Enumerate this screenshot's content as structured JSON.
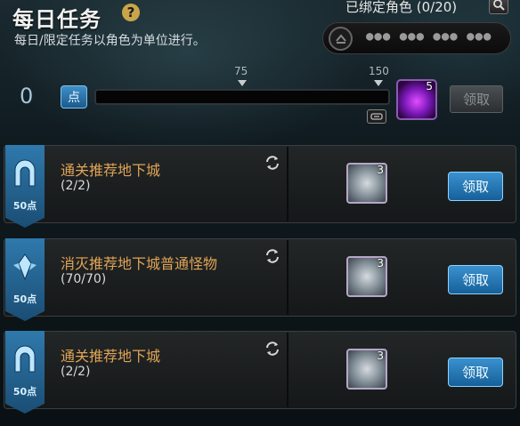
{
  "header": {
    "title": "每日任务",
    "help_icon": "question-mark-icon",
    "subtitle": "每日/限定任务以角色为单位进行。",
    "bound_label": "已绑定角色 (0/20)",
    "character_placeholder": "●●● ●●● ●●● ●●●"
  },
  "progress": {
    "points": "0",
    "points_badge": "点",
    "current": 0,
    "max": 150,
    "milestones": [
      "75",
      "150"
    ],
    "reward_count": "5",
    "claim_label": "领取"
  },
  "quests": [
    {
      "name": "通关推荐地下城",
      "progress": "(2/2)",
      "points": "50点",
      "icon": "dungeon-gate-icon",
      "reward_count": "3",
      "claim_label": "领取"
    },
    {
      "name": "消灭推荐地下城普通怪物",
      "progress": "(70/70)",
      "points": "50点",
      "icon": "crystal-monster-icon",
      "reward_count": "3",
      "claim_label": "领取"
    },
    {
      "name": "通关推荐地下城",
      "progress": "(2/2)",
      "points": "50点",
      "icon": "dungeon-gate-icon",
      "reward_count": "3",
      "claim_label": "领取"
    }
  ],
  "colors": {
    "accent_blue": "#2f79ac",
    "quest_name": "#e0a455",
    "reward_purple": "#7a18b8"
  }
}
